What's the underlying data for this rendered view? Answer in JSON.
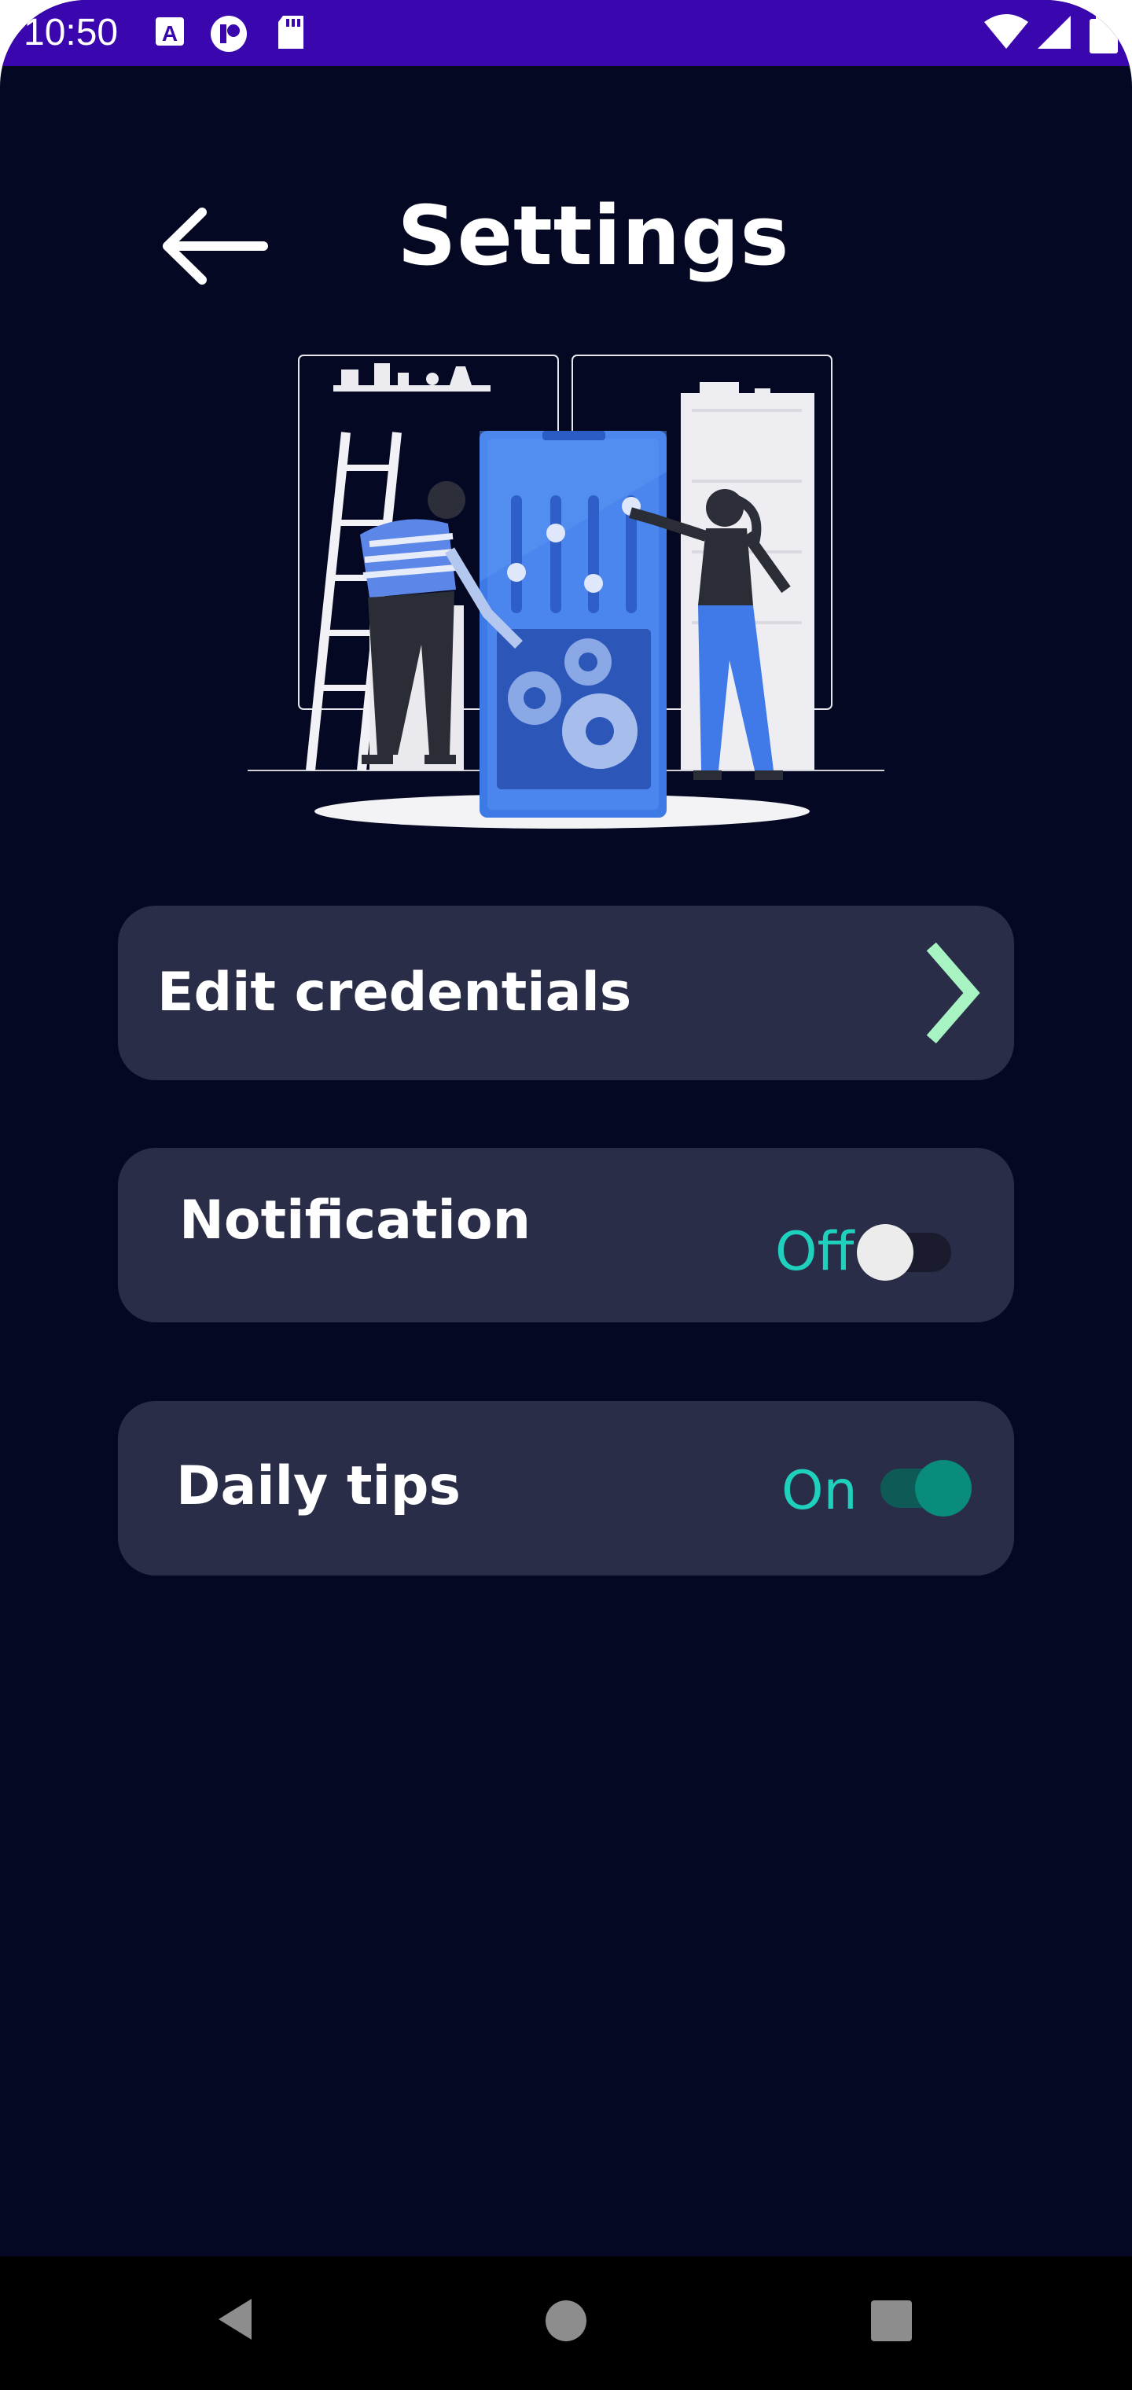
{
  "status_bar": {
    "time": "10:50",
    "icons": [
      "a-icon",
      "badge-icon",
      "sd-card-icon",
      "wifi-icon",
      "signal-icon",
      "battery-icon"
    ]
  },
  "header": {
    "back_icon": "arrow-left-icon",
    "title": "Settings"
  },
  "illustration": {
    "name": "settings-illustration"
  },
  "settings": {
    "edit_credentials": {
      "label": "Edit credentials",
      "icon": "chevron-right-icon",
      "icon_color": "#a7f3c2"
    },
    "notification": {
      "label": "Notification",
      "state_text": "Off",
      "enabled": false
    },
    "daily_tips": {
      "label": "Daily tips",
      "state_text": "On",
      "enabled": true
    }
  },
  "nav_bar": {
    "buttons": [
      "back-triangle-icon",
      "home-circle-icon",
      "recents-square-icon"
    ]
  },
  "colors": {
    "background": "#050823",
    "status_bar": "#3a06ad",
    "card": "#2a2d48",
    "accent_text": "#1fd1bd",
    "toggle_on": "#0a8c7c"
  }
}
